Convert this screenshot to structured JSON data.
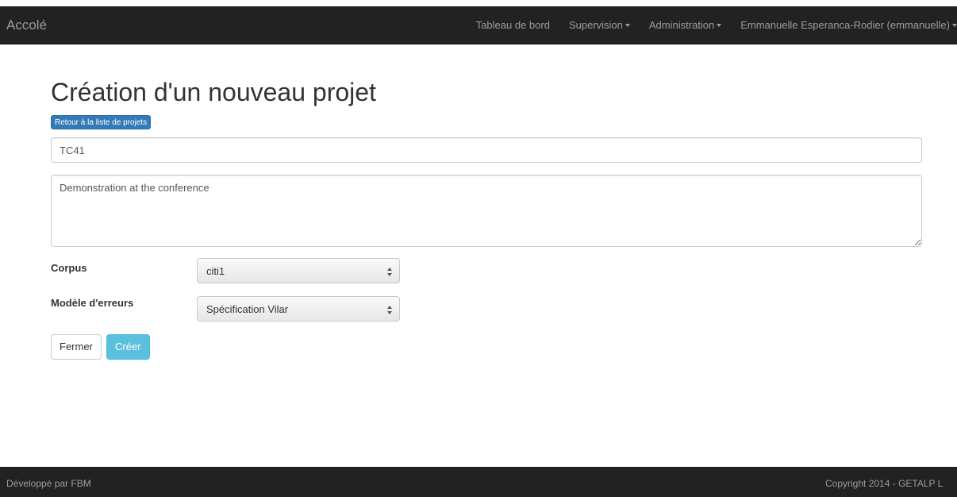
{
  "navbar": {
    "brand": "Accolé",
    "items": [
      {
        "label": "Tableau de bord"
      },
      {
        "label": "Supervision"
      },
      {
        "label": "Administration"
      },
      {
        "label": "Emmanuelle Esperanca-Rodier (emmanuelle)"
      }
    ]
  },
  "main": {
    "title": "Création d'un nouveau projet",
    "back_button": "Retour à la liste de projets",
    "name_field": {
      "value": "TC41"
    },
    "description_field": {
      "value": "Demonstration at the conference"
    },
    "corpus": {
      "label": "Corpus",
      "selected": "citi1"
    },
    "error_model": {
      "label": "Modèle d'erreurs",
      "selected": "Spécification Vilar"
    },
    "buttons": {
      "close": "Fermer",
      "create": "Créer"
    }
  },
  "footer": {
    "left": "Développé par FBM",
    "right": "Copyright 2014 - GETALP L"
  },
  "colors": {
    "navbar_bg": "#222222",
    "nav_text": "#9d9d9d",
    "primary": "#337ab7",
    "info": "#5bc0de"
  }
}
